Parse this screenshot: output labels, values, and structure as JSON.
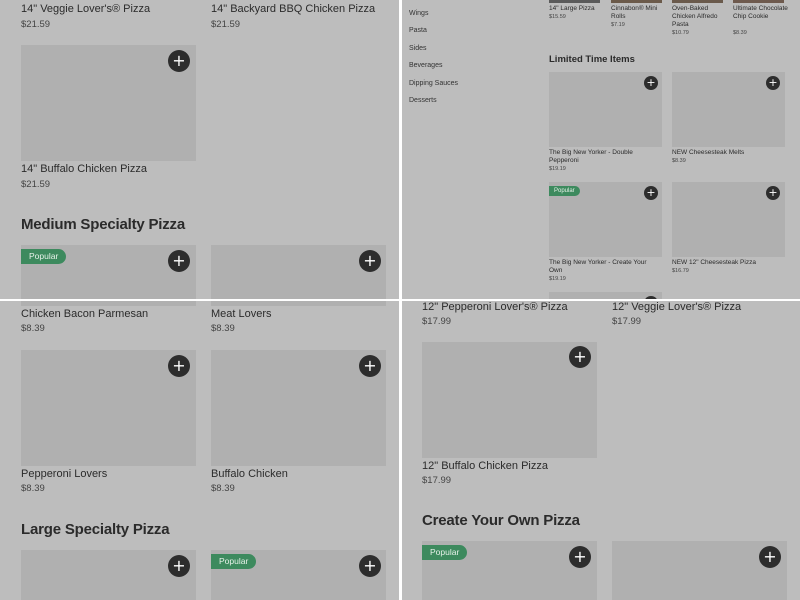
{
  "q1": {
    "top_items": [
      {
        "name": "14\" Veggie Lover's® Pizza",
        "price": "$21.59"
      },
      {
        "name": "14\" Backyard BBQ Chicken Pizza",
        "price": "$21.59"
      }
    ],
    "item3": {
      "name": "14\" Buffalo Chicken Pizza",
      "price": "$21.59"
    },
    "section_title": "Medium Specialty Pizza",
    "popular_badge": "Popular"
  },
  "q2": {
    "sidebar": [
      "Wings",
      "Pasta",
      "Sides",
      "Beverages",
      "Dipping Sauces",
      "Desserts"
    ],
    "top_row": [
      {
        "name": "14\" Large Pizza",
        "price": "$15.59"
      },
      {
        "name": "Cinnabon® Mini Rolls",
        "price": "$7.19"
      },
      {
        "name": "Oven-Baked Chicken Alfredo Pasta",
        "price": "$10.79"
      },
      {
        "name": "Ultimate Chocolate Chip Cookie",
        "price": "$8.39"
      }
    ],
    "section_title": "Limited Time Items",
    "items": [
      {
        "name": "The Big New Yorker - Double Pepperoni",
        "price": "$19.19"
      },
      {
        "name": "NEW Cheesesteak Melts",
        "price": "$8.39"
      },
      {
        "name": "The Big New Yorker - Create Your Own",
        "price": "$19.19"
      },
      {
        "name": "NEW 12\" Cheesesteak Pizza",
        "price": "$16.79"
      }
    ],
    "popular_badge": "Popular"
  },
  "q3": {
    "items": [
      {
        "name": "Chicken Bacon Parmesan",
        "price": "$8.39"
      },
      {
        "name": "Meat Lovers",
        "price": "$8.39"
      },
      {
        "name": "Pepperoni Lovers",
        "price": "$8.39"
      },
      {
        "name": "Buffalo Chicken",
        "price": "$8.39"
      }
    ],
    "section_title": "Large Specialty Pizza",
    "popular_badge": "Popular"
  },
  "q4": {
    "top_items": [
      {
        "name": "12\" Pepperoni Lover's® Pizza",
        "price": "$17.99"
      },
      {
        "name": "12\" Veggie Lover's® Pizza",
        "price": "$17.99"
      }
    ],
    "item3": {
      "name": "12\" Buffalo Chicken Pizza",
      "price": "$17.99"
    },
    "section_title": "Create Your Own Pizza",
    "popular_badge": "Popular"
  },
  "add_symbol": "+",
  "colors": {
    "overlay": "#bdbdbd",
    "image_placeholder": "#b0b0b0",
    "add_button": "#2d2d2d",
    "popular_badge": "#3d8a5e"
  }
}
